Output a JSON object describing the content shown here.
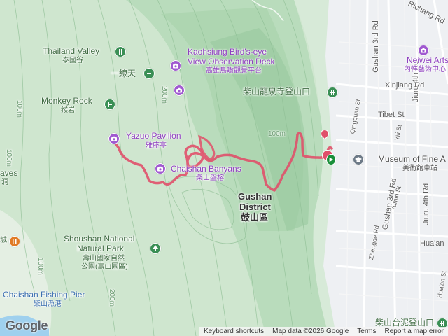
{
  "labels": {
    "thailand_valley": "Thailand Valley",
    "thailand_valley_zh": "泰國谷",
    "yixiantian_zh": "一線天",
    "monkey_rock": "Monkey Rock",
    "monkey_rock_zh": "猴岩",
    "birdseye_line1": "Kaohsiung Bird's-eye",
    "birdseye_line2": "View Observation Deck",
    "birdseye_zh": "高雄鳥瞰觀景平台",
    "chaishan_trail_zh": "柴山龍泉寺登山口",
    "yazuo": "Yazuo Pavilion",
    "yazuo_zh": "雅座亭",
    "banyans": "Chaishan Banyans",
    "banyans_zh": "柴山盤榕",
    "gushan_line1": "Gushan",
    "gushan_line2": "District",
    "gushan_zh": "鼓山區",
    "shoushan_line1": "Shoushan National",
    "shoushan_line2": "Natural Park",
    "shoushan_zh1": "壽山國家自然",
    "shoushan_zh2": "公園(壽山園區)",
    "fishing_pier": "Chaishan Fishing Pier",
    "fishing_pier_zh": "柴山漁港",
    "waves_partial": "aves",
    "waves_zh_partial": "洞",
    "left_edge_zh": "城",
    "neiwei_arts": "Neiwei Arts C",
    "neiwei_zh": "內惟藝術中心",
    "museum_line1": "Museum of Fine A",
    "museum_zh": "美術館車站",
    "mud_trail_zh": "柴山台泥登山口"
  },
  "streets": {
    "richang": "Richang Rd",
    "gushan3_top": "Gushan 3rd Rd",
    "jiuru4_top": "Jiuru 4th Rd",
    "xinjiang": "Xinjiang Rd",
    "tibet": "Tibet St",
    "qingquan": "Qingquan St",
    "yili": "Yili St",
    "yumin": "Yumin St",
    "gushan3_bottom": "Gushan 3rd Rd",
    "jiuru4_bottom": "Jiuru 4th Rd",
    "zhengde": "Zhengde Rd",
    "huaan": "Hua'an",
    "huaan2": "Hua'an St"
  },
  "contours": {
    "c100_left_top": "100m",
    "c200_left": "200m",
    "c100_mid": "100m",
    "c100_left": "100m",
    "c100_left_low": "100m",
    "c200_bottom": "200m"
  },
  "attribution": {
    "shortcuts": "Keyboard shortcuts",
    "map_data": "Map data ©2026 Google",
    "terms": "Terms",
    "report": "Report a map error"
  },
  "logo": "Google",
  "colors": {
    "track": "#e0506a",
    "park_green": "#3a8f55",
    "poi_purple": "#a05ad0"
  }
}
